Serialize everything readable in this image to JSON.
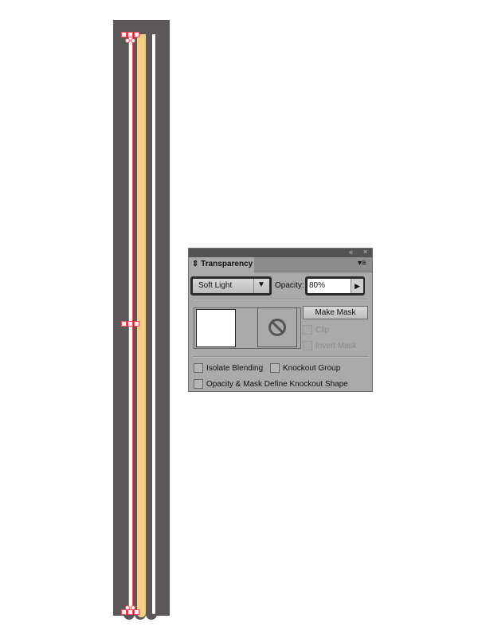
{
  "artwork": {
    "background_color": "#5c5758",
    "stroke_color": "#f2d084",
    "selection_color": "#ff4b5c"
  },
  "panel": {
    "title": "Transparency",
    "blend_mode": "Soft Light",
    "opacity_label": "Opacity:",
    "opacity_value": "80%",
    "make_mask_label": "Make Mask",
    "clip_label": "Clip",
    "invert_mask_label": "Invert Mask",
    "isolate_blending_label": "Isolate Blending",
    "knockout_group_label": "Knockout Group",
    "opacity_mask_label": "Opacity & Mask Define Knockout Shape",
    "collapse_icon": "«",
    "close_icon": "×",
    "menu_icon": "▾≡"
  }
}
